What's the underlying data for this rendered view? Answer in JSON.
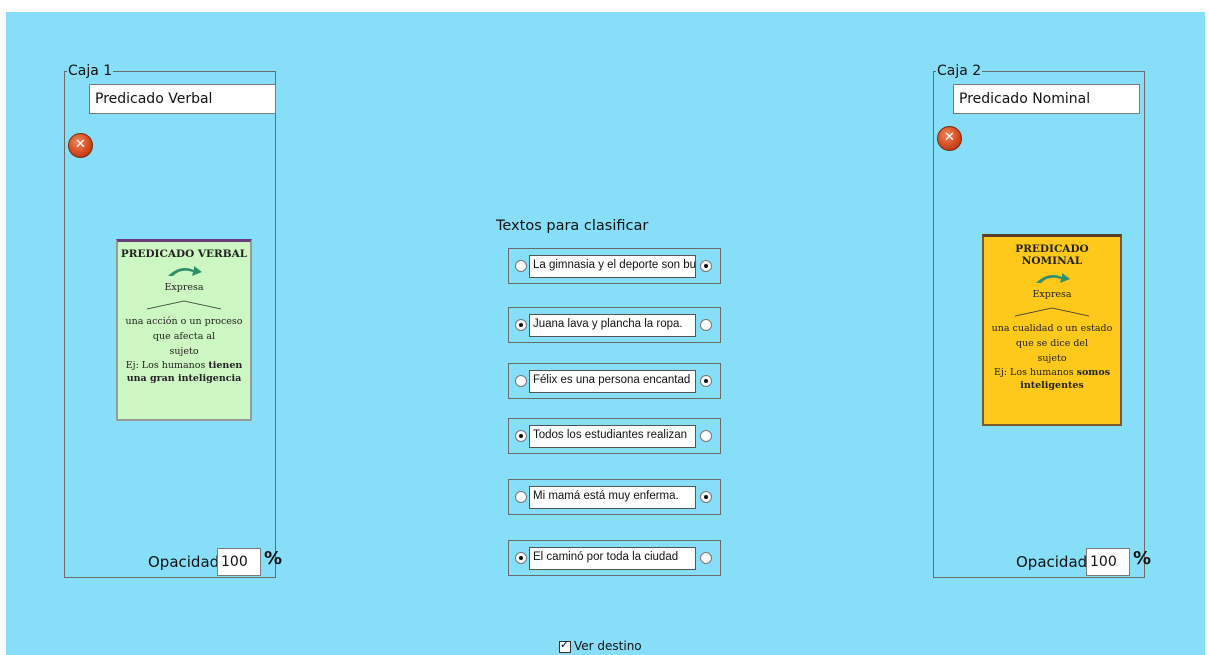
{
  "box1": {
    "legend": "Caja 1",
    "name_value": "Predicado Verbal",
    "delete_icon": "close-icon",
    "card": {
      "title": "PREDICADO VERBAL",
      "expresa": "Expresa",
      "line1": "una acción   o   un proceso",
      "line2": "que afecta al",
      "line3": "sujeto",
      "example_prefix": "Ej: Los humanos ",
      "example_bold": "tienen una gran inteligencia",
      "bg": "#cdf7c2"
    },
    "opacity_label": "Opacidad",
    "opacity_value": "100",
    "percent": "%"
  },
  "box2": {
    "legend": "Caja 2",
    "name_value": "Predicado Nominal",
    "delete_icon": "close-icon",
    "card": {
      "title": "PREDICADO NOMINAL",
      "expresa": "Expresa",
      "line1": "una cualidad o un estado",
      "line2": "que se dice del",
      "line3": "sujeto",
      "example_prefix": "Ej: Los humanos ",
      "example_bold": "somos inteligentes",
      "bg": "#fec91a"
    },
    "opacity_label": "Opacidad",
    "opacity_value": "100",
    "percent": "%"
  },
  "center": {
    "title": "Textos para clasificar",
    "items": [
      {
        "text": "La gimnasia y el deporte son bu",
        "selected": "right"
      },
      {
        "text": "Juana lava y plancha la ropa.",
        "selected": "left"
      },
      {
        "text": "Félix es una persona encantad",
        "selected": "right"
      },
      {
        "text": "Todos los estudiantes realizan",
        "selected": "left"
      },
      {
        "text": "Mi mamá está muy enferma.",
        "selected": "right"
      },
      {
        "text": "El caminó por toda la ciudad",
        "selected": "left"
      }
    ]
  },
  "footer": {
    "ver_destino_label": "Ver destino",
    "ver_destino_checked": true
  },
  "colors": {
    "background": "#87def9",
    "accent_delete": "#d34a20"
  }
}
